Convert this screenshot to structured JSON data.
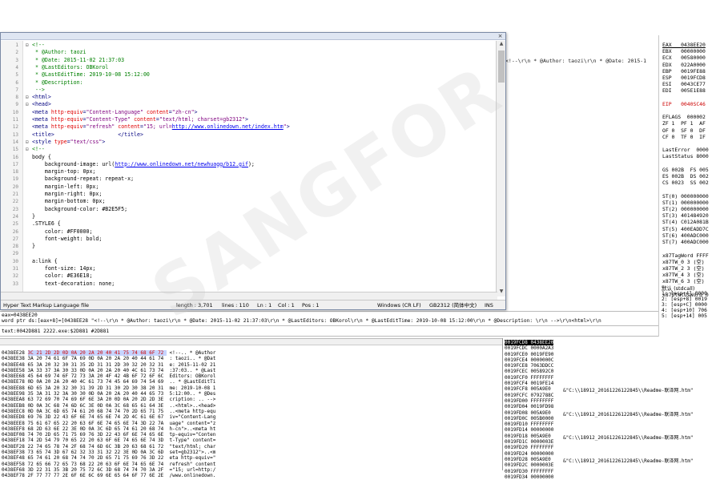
{
  "editor": {
    "lines": [
      {
        "n": "1",
        "f": "⊟",
        "segs": [
          [
            "cmt",
            "<!--"
          ]
        ]
      },
      {
        "n": "2",
        "f": "",
        "segs": [
          [
            "cmt",
            " * @Author: taozi"
          ]
        ]
      },
      {
        "n": "3",
        "f": "",
        "segs": [
          [
            "cmt",
            " * @Date: 2015-11-02 21:37:03"
          ]
        ]
      },
      {
        "n": "4",
        "f": "",
        "segs": [
          [
            "cmt",
            " * @LastEditors: OBKorol"
          ]
        ]
      },
      {
        "n": "5",
        "f": "",
        "segs": [
          [
            "cmt",
            " * @LastEditTime: 2019-10-08 15:12:00"
          ]
        ]
      },
      {
        "n": "6",
        "f": "",
        "segs": [
          [
            "cmt",
            " * @Description:"
          ]
        ]
      },
      {
        "n": "7",
        "f": "",
        "segs": [
          [
            "cmt",
            " -->"
          ]
        ]
      },
      {
        "n": "8",
        "f": "⊟",
        "segs": [
          [
            "tag",
            "<html>"
          ]
        ]
      },
      {
        "n": "9",
        "f": "⊟",
        "segs": [
          [
            "tag",
            "<head>"
          ]
        ]
      },
      {
        "n": "10",
        "f": "",
        "segs": [
          [
            "tag",
            "<meta "
          ],
          [
            "att",
            "http-equiv"
          ],
          [
            "tag",
            "="
          ],
          [
            "str",
            "\"Content-Language\""
          ],
          [
            "tag",
            " "
          ],
          [
            "att",
            "content"
          ],
          [
            "tag",
            "="
          ],
          [
            "str",
            "\"zh-cn\""
          ],
          [
            "tag",
            ">"
          ]
        ]
      },
      {
        "n": "11",
        "f": "",
        "segs": [
          [
            "tag",
            "<meta "
          ],
          [
            "att",
            "http-equiv"
          ],
          [
            "tag",
            "="
          ],
          [
            "str",
            "\"Content-Type\""
          ],
          [
            "tag",
            " "
          ],
          [
            "att",
            "content"
          ],
          [
            "tag",
            "="
          ],
          [
            "str",
            "\"text/html; charset=gb2312\""
          ],
          [
            "tag",
            ">"
          ]
        ]
      },
      {
        "n": "12",
        "f": "",
        "segs": [
          [
            "tag",
            "<meta "
          ],
          [
            "att",
            "http-equiv"
          ],
          [
            "tag",
            "="
          ],
          [
            "str",
            "\"refresh\""
          ],
          [
            "tag",
            " "
          ],
          [
            "att",
            "content"
          ],
          [
            "tag",
            "="
          ],
          [
            "str",
            "\"15; url="
          ],
          [
            "url",
            "http://www.onlinedown.net/index.htm"
          ],
          [
            "str",
            "\""
          ],
          [
            "tag",
            ">"
          ]
        ]
      },
      {
        "n": "13",
        "f": "",
        "segs": [
          [
            "tag",
            "<title>"
          ],
          [
            "",
            "                    "
          ],
          [
            "tag",
            "</title>"
          ]
        ]
      },
      {
        "n": "14",
        "f": "⊟",
        "segs": [
          [
            "tag",
            "<style "
          ],
          [
            "att",
            "type"
          ],
          [
            "tag",
            "="
          ],
          [
            "str",
            "\"text/css\""
          ],
          [
            "tag",
            ">"
          ]
        ]
      },
      {
        "n": "15",
        "f": "⊟",
        "segs": [
          [
            "cmt",
            "<!--"
          ]
        ]
      },
      {
        "n": "16",
        "f": "",
        "segs": [
          [
            "",
            "body {"
          ]
        ]
      },
      {
        "n": "17",
        "f": "",
        "segs": [
          [
            "",
            "    background-image: url("
          ],
          [
            "url",
            "http://www.onlinedown.net/newhuagg/b12.gif"
          ],
          [
            "",
            ");"
          ]
        ]
      },
      {
        "n": "18",
        "f": "",
        "segs": [
          [
            "",
            "    margin-top: 0px;"
          ]
        ]
      },
      {
        "n": "19",
        "f": "",
        "segs": [
          [
            "",
            "    background-repeat: repeat-x;"
          ]
        ]
      },
      {
        "n": "20",
        "f": "",
        "segs": [
          [
            "",
            "    margin-left: 0px;"
          ]
        ]
      },
      {
        "n": "21",
        "f": "",
        "segs": [
          [
            "",
            "    margin-right: 0px;"
          ]
        ]
      },
      {
        "n": "22",
        "f": "",
        "segs": [
          [
            "",
            "    margin-bottom: 0px;"
          ]
        ]
      },
      {
        "n": "23",
        "f": "",
        "segs": [
          [
            "",
            "    background-color: #B2E5F5;"
          ]
        ]
      },
      {
        "n": "24",
        "f": "",
        "segs": [
          [
            "",
            "}"
          ]
        ]
      },
      {
        "n": "25",
        "f": "",
        "segs": [
          [
            "",
            ".STYLE6 {"
          ]
        ]
      },
      {
        "n": "26",
        "f": "",
        "segs": [
          [
            "",
            "    color: #FF0000;"
          ]
        ]
      },
      {
        "n": "27",
        "f": "",
        "segs": [
          [
            "",
            "    font-weight: bold;"
          ]
        ]
      },
      {
        "n": "28",
        "f": "",
        "segs": [
          [
            "",
            "}"
          ]
        ]
      },
      {
        "n": "29",
        "f": "",
        "segs": [
          [
            "",
            ""
          ]
        ]
      },
      {
        "n": "30",
        "f": "",
        "segs": [
          [
            "",
            "a:link {"
          ]
        ]
      },
      {
        "n": "31",
        "f": "",
        "segs": [
          [
            "",
            "    font-size: 14px;"
          ]
        ]
      },
      {
        "n": "32",
        "f": "",
        "segs": [
          [
            "",
            "    color: #E36E18;"
          ]
        ]
      },
      {
        "n": "33",
        "f": "",
        "segs": [
          [
            "",
            "    text-decoration: none;"
          ]
        ]
      }
    ],
    "status": {
      "lang": "Hyper Text Markup Language file",
      "length": "length : 3,701",
      "lines": "lines : 110",
      "ln": "Ln : 1",
      "col": "Col : 1",
      "pos": "Pos : 1",
      "eol": "Windows (CR LF)",
      "enc": "GB2312 (简体中文)",
      "ins": "INS"
    },
    "close": "×"
  },
  "debugger": {
    "topline": "<!--\\r\\n * @Author: taozi\\r\\n * @Date: 2015-1",
    "info1": "eax=0438EE20",
    "info2": "word ptr ds:[eax+8]=[0438EE28 \"<!--\\r\\n * @Author: taozi\\r\\n * @Date: 2015-11-02 21:37:03\\r\\n * @LastEditors: OBKorol\\r\\n * @LastEditTime: 2019-10-08 15:12:00\\r\\n * @Description: \\r\\n -->\\r\\n<html>\\r\\n",
    "info3": "text:0042D881 2222.exe:$2D881 #2D881",
    "regs": [
      "EAX   0438EE20",
      "EBX   00000000",
      "ECX   00580000",
      "EDX   022A0000",
      "EBP   0019FE88",
      "ESP   0019FCD8",
      "ESI   0043CE77",
      "EDI   005E1E88",
      "",
      "EIP   0040SC46",
      "",
      "EFLAGS  000002",
      "ZF 1  PF 1  AF",
      "OF 0  SF 0  DF",
      "CF 0  TF 0  IF",
      "",
      "LastError  0000",
      "LastStatus 8000",
      "",
      "GS 002B  FS 005",
      "ES 002B  DS 002",
      "CS 0023  SS 002",
      "",
      "ST(0) 000000000",
      "ST(1) 000000000",
      "ST(2) 000000000",
      "ST(3) 401484920",
      "ST(4) C012A081B",
      "ST(5) 400EADD7C",
      "ST(6) 400ADC000",
      "ST(7) 400ADC000",
      "",
      "x87TagWord FFFF",
      "x87TW_0 3 (空)",
      "x87TW_2 3 (空)",
      "x87TW_4 3 (空)",
      "x87TW_6 3 (空)",
      "",
      "x87StatusWord 0"
    ],
    "callconv": "默认 (stdcall)",
    "args": [
      "1: [esp+4] 0000",
      "2: [esp+8] 0019",
      "3: [esp+C] 0000",
      "4: [esp+10] 706",
      "5: [esp+14] 005"
    ],
    "dump": [
      "0438EE28 3C 21 2D 2D 0D 0A 20 2A 20 40 41 75 74 68 6F 72  <!--.. * @Author",
      "0438EE38 3A 20 74 61 6F 7A 69 0D 0A 20 2A 20 40 44 61 74  : taozi.. * @Dat",
      "0438EE48 65 3A 20 32 30 31 35 2D 31 31 2D 30 32 20 32 31  e: 2015-11-02 21",
      "0438EE58 3A 33 37 3A 30 33 0D 0A 20 2A 20 40 4C 61 73 74  :37:03.. * @Last",
      "0438EE68 45 64 69 74 6F 72 73 3A 20 4F 42 4B 6F 72 6F 6C  Editors: OBKorol",
      "0438EE78 0D 0A 20 2A 20 40 4C 61 73 74 45 64 69 74 54 69  .. * @LastEditTi",
      "0438EE88 6D 65 3A 20 32 30 31 39 2D 31 30 2D 30 38 20 31  me: 2019-10-08 1",
      "0438EE98 35 3A 31 32 3A 30 30 0D 0A 20 2A 20 40 44 65 73  5:12:00.. * @Des",
      "0438EEA8 63 72 69 70 74 69 6F 6E 3A 20 0D 0A 20 2D 2D 3E  cription: .. -->",
      "0438EEB8 0D 0A 3C 68 74 6D 6C 3E 0D 0A 3C 68 65 61 64 3E  ..<html>..<head>",
      "0438EEC8 0D 0A 3C 6D 65 74 61 20 68 74 74 70 2D 65 71 75  ..<meta http-equ",
      "0438EED8 69 76 3D 22 43 6F 6E 74 65 6E 74 2D 4C 61 6E 67  iv=\"Content-Lang",
      "0438EEE8 75 61 67 65 22 20 63 6F 6E 74 65 6E 74 3D 22 7A  uage\" content=\"z",
      "0438EEF8 68 2D 63 6E 22 3E 0D 0A 3C 6D 65 74 61 20 68 74  h-cn\">..<meta ht",
      "0438EF08 74 70 2D 65 71 75 69 76 3D 22 43 6F 6E 74 65 6E  tp-equiv=\"Conten",
      "0438EF18 74 2D 54 79 70 65 22 20 63 6F 6E 74 65 6E 74 3D  t-Type\" content=",
      "0438EF28 22 74 65 78 74 2F 68 74 6D 6C 3B 20 63 68 61 72  \"text/html; char",
      "0438EF38 73 65 74 3D 67 62 32 33 31 32 22 3E 0D 0A 3C 6D  set=gb2312\">..<m",
      "0438EF48 65 74 61 20 68 74 74 70 2D 65 71 75 69 76 3D 22  eta http-equiv=\"",
      "0438EF58 72 65 66 72 65 73 68 22 20 63 6F 6E 74 65 6E 74  refresh\" content",
      "0438EF68 3D 22 31 35 3B 20 75 72 6C 3D 68 74 74 70 3A 2F  =\"15; url=http:/",
      "0438EF78 2F 77 77 77 2E 6F 6E 6C 69 6E 65 64 6F 77 6E 2E  /www.onlinedown."
    ],
    "stack": [
      "0019FCD8 0438EE20",
      "0019FCDC 0000A2A3",
      "0019FCE0 0019FE90",
      "0019FCE4 0000000C",
      "0019FCE8 7063DDCC",
      "0019FCEC 005892C0",
      "0019FCF0 FFFFFFFF",
      "0019FCF4 0019FE14",
      "0019FCF8 005A9E0",
      "0019FCFC 0792788C",
      "0019FD00 FFFFFFFF",
      "0019FD04 0019FD98",
      "0019FD08 005A9E0",
      "0019FD0C 005B0000",
      "0019FD10 FFFFFFFF",
      "0019FD14 00000000",
      "0019FD18 005A9E0",
      "0019FD1C 0000003E",
      "0019FD20 FFFFFFFF",
      "0019FD24 00000000",
      "0019FD28 005A9E0",
      "0019FD2C 0000003E",
      "0019FD30 FFFFFFFF",
      "0019FD34 00000000"
    ],
    "stack_comments": [
      {
        "row": 8,
        "text": "&\"C:\\\\18912_20161226122845\\\\Readme-联泽网.htm\""
      },
      {
        "row": 12,
        "text": "&\"C:\\\\18912_20161226122845\\\\Readme-联泽网.htm\""
      },
      {
        "row": 16,
        "text": "&\"C:\\\\18912_20161226122845\\\\Readme-联泽网.htm\""
      },
      {
        "row": 20,
        "text": "&\"C:\\\\18912_20161226122845\\\\Readme-联泽网.htm\""
      }
    ]
  },
  "watermark": "SANGFOR",
  "colors": {
    "comment": "#008000",
    "tag": "#00007f",
    "attr": "#e00000",
    "string": "#7f007f",
    "url": "#0000ee",
    "selection": "#000000"
  }
}
